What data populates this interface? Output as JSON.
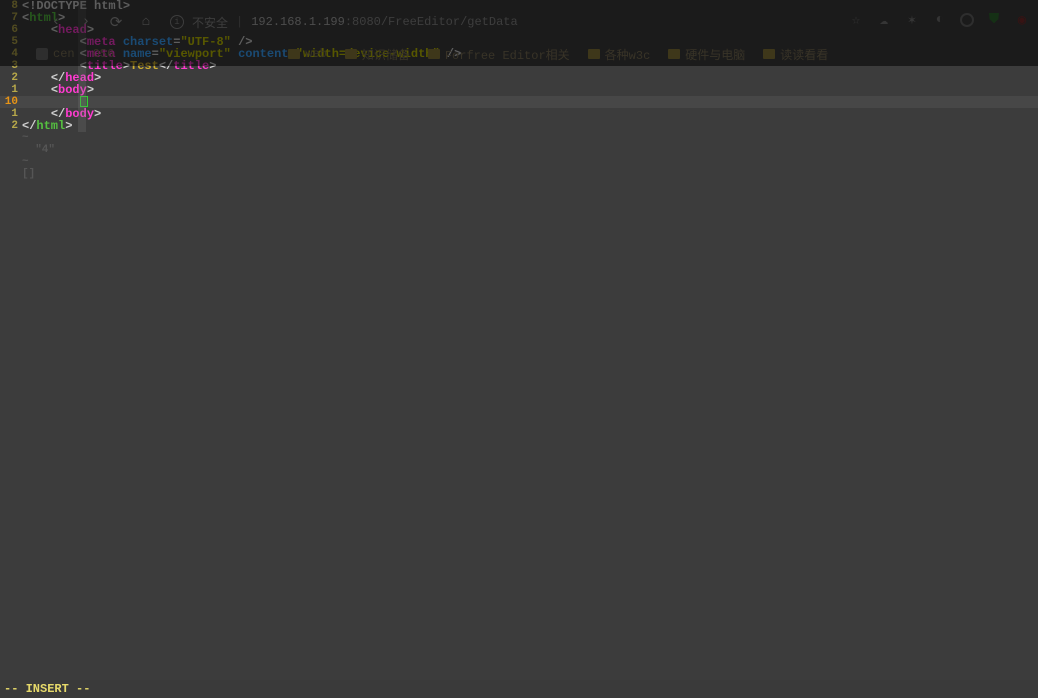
{
  "browser": {
    "back_icon": "‹",
    "forward_icon": "›",
    "reload_icon": "⟳",
    "home_icon": "⌂",
    "security_label": "不安全",
    "url_host": "192.168.1.199",
    "url_port": ":8080",
    "url_path": "/FreeEditor/getData",
    "star_icon": "☆",
    "ext_icons": [
      "⬡",
      "⬡",
      "⬡",
      "⚙",
      "⛉",
      "◉"
    ]
  },
  "bookmarks": [
    {
      "label": "cen",
      "kind": "icon"
    },
    {
      "label": "OS6",
      "kind": "text"
    },
    {
      "label": "",
      "kind": "spacer"
    },
    {
      "label": "",
      "kind": "spacer"
    },
    {
      "label": "web",
      "kind": "folder"
    },
    {
      "label": "知识储备",
      "kind": "folder"
    },
    {
      "label": "Forfree Editor相关",
      "kind": "folder"
    },
    {
      "label": "各种w3c",
      "kind": "folder"
    },
    {
      "label": "硬件与电脑",
      "kind": "folder"
    },
    {
      "label": "读读看看",
      "kind": "folder"
    }
  ],
  "editor": {
    "gutter": [
      "8",
      "7",
      "6",
      "5",
      "4",
      "3",
      "2",
      "1",
      "10",
      "1",
      "2"
    ],
    "current_line_index": 8,
    "lines": [
      {
        "indent": 0,
        "tokens": [
          {
            "c": "t-bracket",
            "t": "<!"
          },
          {
            "c": "t-doctype",
            "t": "DOCTYPE html"
          },
          {
            "c": "t-bracket",
            "t": ">"
          }
        ]
      },
      {
        "indent": 0,
        "tokens": [
          {
            "c": "t-bracket",
            "t": "<"
          },
          {
            "c": "t-tag-html",
            "t": "html"
          },
          {
            "c": "t-bracket",
            "t": ">"
          }
        ]
      },
      {
        "indent": 1,
        "tokens": [
          {
            "c": "t-bracket",
            "t": "<"
          },
          {
            "c": "t-tag-head",
            "t": "head"
          },
          {
            "c": "t-bracket",
            "t": ">"
          }
        ]
      },
      {
        "indent": 2,
        "tokens": [
          {
            "c": "t-bracket",
            "t": "<"
          },
          {
            "c": "t-tag-meta",
            "t": "meta"
          },
          {
            "c": "",
            "t": " "
          },
          {
            "c": "t-attr",
            "t": "charset"
          },
          {
            "c": "t-punc",
            "t": "="
          },
          {
            "c": "t-str",
            "t": "\"UTF-8\""
          },
          {
            "c": "",
            "t": " "
          },
          {
            "c": "t-bracket",
            "t": "/>"
          }
        ]
      },
      {
        "indent": 2,
        "tokens": [
          {
            "c": "t-bracket",
            "t": "<"
          },
          {
            "c": "t-tag-meta",
            "t": "meta"
          },
          {
            "c": "",
            "t": " "
          },
          {
            "c": "t-attr",
            "t": "name"
          },
          {
            "c": "t-punc",
            "t": "="
          },
          {
            "c": "t-str",
            "t": "\"viewport\""
          },
          {
            "c": "",
            "t": " "
          },
          {
            "c": "t-attr",
            "t": "content"
          },
          {
            "c": "t-punc",
            "t": "="
          },
          {
            "c": "t-str",
            "t": "\"width=device-width\""
          },
          {
            "c": "",
            "t": " "
          },
          {
            "c": "t-bracket",
            "t": "/>"
          }
        ]
      },
      {
        "indent": 2,
        "tokens": [
          {
            "c": "t-bracket",
            "t": "<"
          },
          {
            "c": "t-tag-title",
            "t": "title"
          },
          {
            "c": "t-bracket",
            "t": ">"
          },
          {
            "c": "t-text",
            "t": "Test"
          },
          {
            "c": "t-bracket",
            "t": "</"
          },
          {
            "c": "t-tag-title",
            "t": "title"
          },
          {
            "c": "t-bracket",
            "t": ">"
          }
        ]
      },
      {
        "indent": 1,
        "tokens": [
          {
            "c": "t-bracket",
            "t": "</"
          },
          {
            "c": "t-tag-head",
            "t": "head"
          },
          {
            "c": "t-bracket",
            "t": ">"
          }
        ]
      },
      {
        "indent": 1,
        "tokens": [
          {
            "c": "t-bracket",
            "t": "<"
          },
          {
            "c": "t-tag-body",
            "t": "body"
          },
          {
            "c": "t-bracket",
            "t": ">"
          }
        ]
      },
      {
        "indent": 2,
        "cursor": true,
        "tokens": []
      },
      {
        "indent": 1,
        "tokens": [
          {
            "c": "t-bracket",
            "t": "</"
          },
          {
            "c": "t-tag-body",
            "t": "body"
          },
          {
            "c": "t-bracket",
            "t": ">"
          }
        ]
      },
      {
        "indent": 0,
        "tokens": [
          {
            "c": "t-bracket",
            "t": "</"
          },
          {
            "c": "t-tag-html",
            "t": "html"
          },
          {
            "c": "t-bracket",
            "t": ">"
          }
        ]
      }
    ],
    "after_lines": [
      "~",
      "  \"4\"",
      "~",
      "[]"
    ],
    "indent_marker": "▏"
  },
  "status": {
    "mode": "-- INSERT --"
  }
}
